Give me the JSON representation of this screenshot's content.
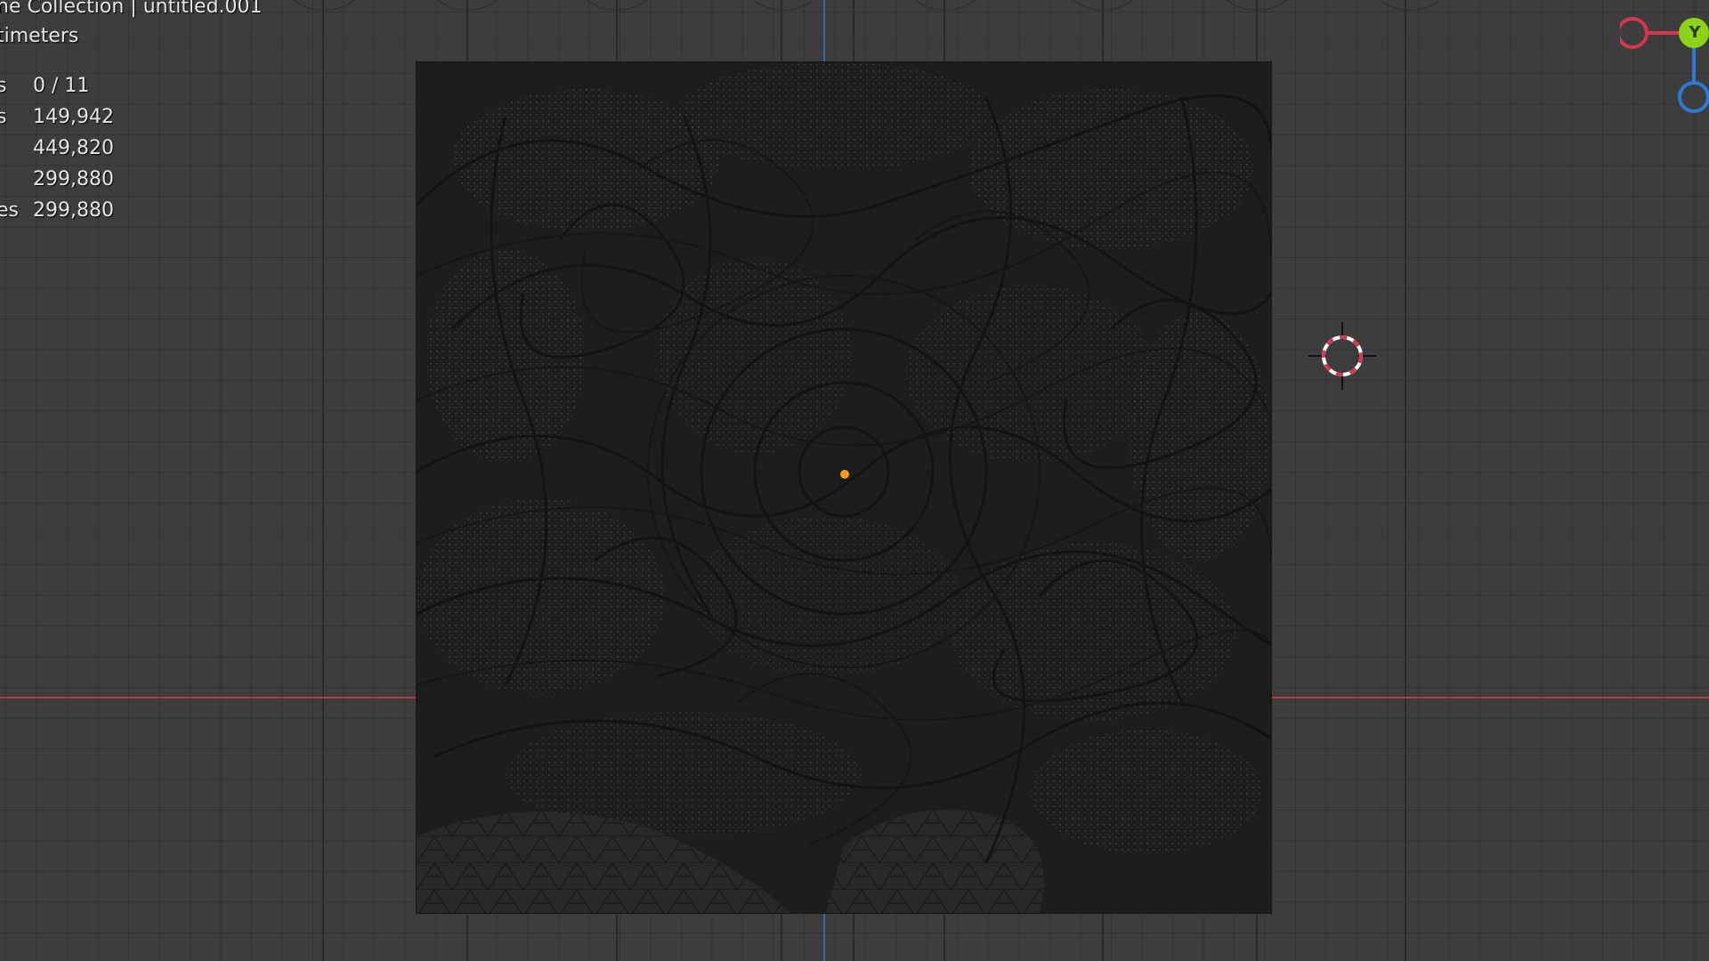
{
  "viewport": {
    "overlay_line1": "ne Collection | untitled.001",
    "overlay_line2": "timeters",
    "stats": [
      {
        "label": "s",
        "value": "0 / 11"
      },
      {
        "label": "s",
        "value": "149,942"
      },
      {
        "label": "",
        "value": "449,820"
      },
      {
        "label": "",
        "value": "299,880"
      },
      {
        "label": "es",
        "value": "299,880"
      }
    ]
  },
  "gizmo": {
    "y_label": "Y",
    "x_color": "#d8364f",
    "y_color": "#8cd11a",
    "z_color": "#2f79d6"
  },
  "colors": {
    "background": "#3d3d3d",
    "x_axis": "#b1394a",
    "z_axis": "#2f64b8",
    "origin": "#ff9a1f",
    "object": "#1d1d1d"
  },
  "icons": {
    "cursor": "3d-cursor-icon",
    "origin": "object-origin-dot",
    "gizmo": "navigation-gizmo"
  }
}
